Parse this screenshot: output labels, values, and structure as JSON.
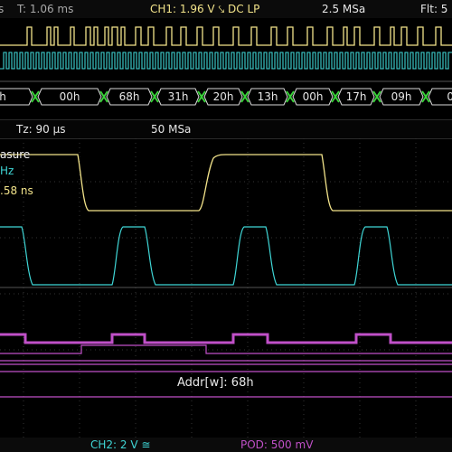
{
  "status": {
    "left_partial": "s",
    "time_label": "T: 1.06 ms",
    "ch1_label": "CH1: 1.96 V ⤥ DC LP",
    "sample_rate": "2.5 MSa",
    "filter_partial": "Flt: 5"
  },
  "bus_overview": {
    "segments": [
      "h",
      "00h",
      "68h",
      "31h",
      "20h",
      "13h",
      "00h",
      "17h",
      "09h",
      "09"
    ]
  },
  "zoom": {
    "tz_label": "Tz: 90 µs",
    "sample_rate": "50 MSa"
  },
  "measure": {
    "title_partial": "asure",
    "freq_partial": "Hz",
    "rise_partial": ".58 ns"
  },
  "decode": {
    "label": "Addr[w]: 68h"
  },
  "footer": {
    "ch2_label": "CH2: 2 V ≅",
    "pod_label": "POD: 500 mV"
  },
  "colors": {
    "ch1": "#f2e38a",
    "ch2": "#3fd6d6",
    "digital": "#c050c8",
    "bus_green": "#39d039"
  }
}
